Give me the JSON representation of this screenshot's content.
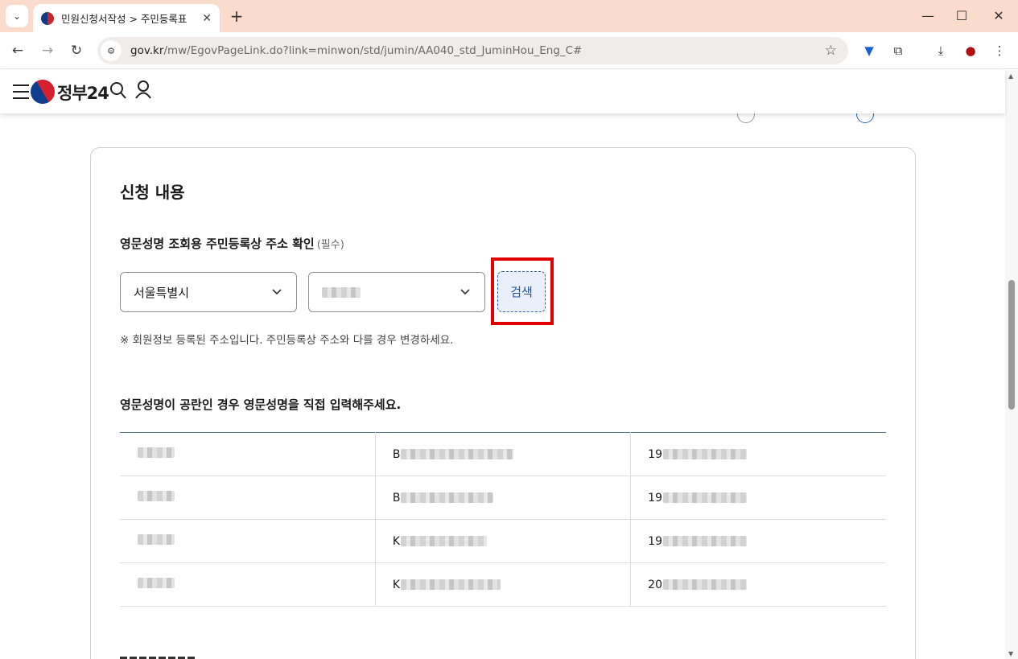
{
  "browser": {
    "tab_title": "민원신청서작성 > 주민등록표",
    "url_domain": "gov.kr",
    "url_path": "/mw/EgovPageLink.do?link=minwon/std/jumin/AA040_std_JuminHou_Eng_C#",
    "icons": [
      "tab-search-icon",
      "close-icon",
      "plus-icon",
      "minimize-icon",
      "maximize-icon",
      "window-close-icon",
      "back-icon",
      "forward-icon",
      "reload-icon",
      "site-info-icon",
      "star-icon",
      "extension-vpn-icon",
      "puzzle-icon",
      "download-icon",
      "profile-icon",
      "kebab-menu-icon"
    ]
  },
  "header": {
    "logo_text": "정부24",
    "icons": [
      "hamburger-icon",
      "logo-mark-icon",
      "search-icon",
      "user-icon"
    ]
  },
  "form": {
    "section_title": "신청 내용",
    "field_label": "영문성명 조회용 주민등록상 주소 확인",
    "required_tag": "(필수)",
    "sido_select": "서울특별시",
    "search_button": "검색",
    "note": "※ 회원정보 등록된 주소입니다. 주민등록상 주소와 다를 경우 변경하세요.",
    "names_heading": "영문성명이 공란인 경우 영문성명을 직접 입력해주세요.",
    "rows": [
      {
        "col2_lead": "B",
        "col3_lead": "19"
      },
      {
        "col2_lead": "B",
        "col3_lead": "19"
      },
      {
        "col2_lead": "K",
        "col3_lead": "19"
      },
      {
        "col2_lead": "K",
        "col3_lead": "20"
      }
    ]
  },
  "colors": {
    "tabbar": "#f9dccb",
    "highlight": "#e00000",
    "search_button_bg": "#e9f0fb",
    "search_button_text": "#1f4f9c"
  }
}
